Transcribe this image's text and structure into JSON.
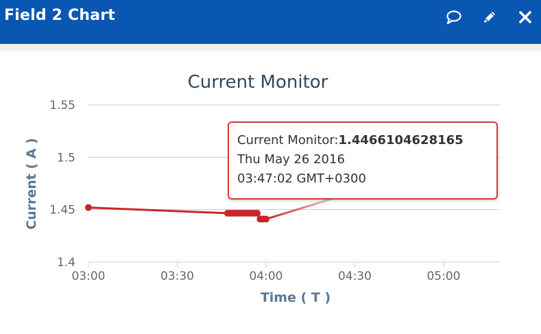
{
  "header": {
    "title": "Field 2 Chart",
    "icons": [
      "comment-icon",
      "pencil-icon",
      "close-icon"
    ],
    "background_color": "#0a57b3"
  },
  "chart_data": {
    "type": "line",
    "title": "Current Monitor",
    "xlabel": "Time ( T )",
    "ylabel": "Current ( A )",
    "series": [
      {
        "name": "Current Monitor",
        "color": "#c62828",
        "x": [
          "03:00",
          "03:47",
          "03:48",
          "03:49",
          "03:50",
          "03:51",
          "03:52",
          "03:53",
          "03:54",
          "03:55",
          "03:56",
          "03:57",
          "03:58",
          "03:59",
          "04:00",
          "05:15"
        ],
        "y": [
          1.452,
          1.4466,
          1.4466,
          1.4466,
          1.4466,
          1.4466,
          1.4466,
          1.4466,
          1.4466,
          1.4466,
          1.4466,
          1.4466,
          1.441,
          1.441,
          1.441,
          1.506
        ]
      }
    ],
    "x_ticks": [
      "03:00",
      "03:30",
      "04:00",
      "04:30",
      "05:00"
    ],
    "y_ticks": [
      "1.4",
      "1.45",
      "1.5",
      "1.55"
    ],
    "xlim": [
      "03:00",
      "05:19"
    ],
    "ylim": [
      1.4,
      1.55
    ],
    "grid": true,
    "tooltip": {
      "label": "Current Monitor:",
      "value": "1.4466104628165",
      "date": "Thu May 26 2016",
      "time": "03:47:02 GMT+0300"
    }
  }
}
